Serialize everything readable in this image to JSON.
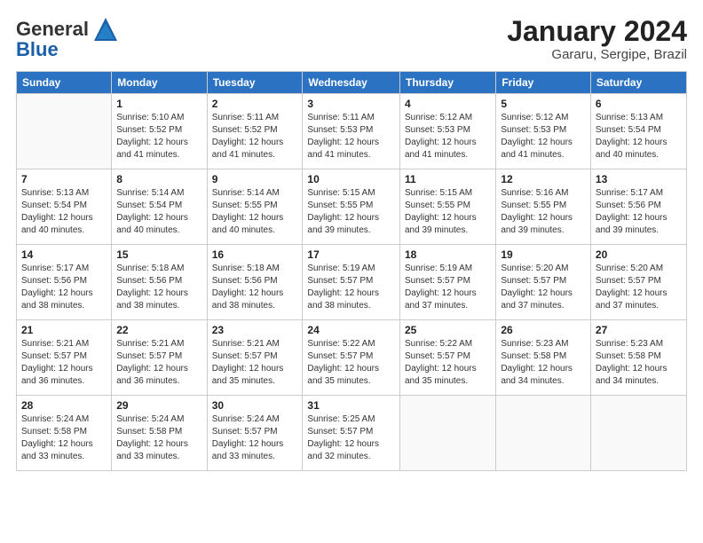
{
  "header": {
    "logo_general": "General",
    "logo_blue": "Blue",
    "month": "January 2024",
    "location": "Gararu, Sergipe, Brazil"
  },
  "weekdays": [
    "Sunday",
    "Monday",
    "Tuesday",
    "Wednesday",
    "Thursday",
    "Friday",
    "Saturday"
  ],
  "weeks": [
    [
      {
        "day": "",
        "info": ""
      },
      {
        "day": "1",
        "info": "Sunrise: 5:10 AM\nSunset: 5:52 PM\nDaylight: 12 hours\nand 41 minutes."
      },
      {
        "day": "2",
        "info": "Sunrise: 5:11 AM\nSunset: 5:52 PM\nDaylight: 12 hours\nand 41 minutes."
      },
      {
        "day": "3",
        "info": "Sunrise: 5:11 AM\nSunset: 5:53 PM\nDaylight: 12 hours\nand 41 minutes."
      },
      {
        "day": "4",
        "info": "Sunrise: 5:12 AM\nSunset: 5:53 PM\nDaylight: 12 hours\nand 41 minutes."
      },
      {
        "day": "5",
        "info": "Sunrise: 5:12 AM\nSunset: 5:53 PM\nDaylight: 12 hours\nand 41 minutes."
      },
      {
        "day": "6",
        "info": "Sunrise: 5:13 AM\nSunset: 5:54 PM\nDaylight: 12 hours\nand 40 minutes."
      }
    ],
    [
      {
        "day": "7",
        "info": "Sunrise: 5:13 AM\nSunset: 5:54 PM\nDaylight: 12 hours\nand 40 minutes."
      },
      {
        "day": "8",
        "info": "Sunrise: 5:14 AM\nSunset: 5:54 PM\nDaylight: 12 hours\nand 40 minutes."
      },
      {
        "day": "9",
        "info": "Sunrise: 5:14 AM\nSunset: 5:55 PM\nDaylight: 12 hours\nand 40 minutes."
      },
      {
        "day": "10",
        "info": "Sunrise: 5:15 AM\nSunset: 5:55 PM\nDaylight: 12 hours\nand 39 minutes."
      },
      {
        "day": "11",
        "info": "Sunrise: 5:15 AM\nSunset: 5:55 PM\nDaylight: 12 hours\nand 39 minutes."
      },
      {
        "day": "12",
        "info": "Sunrise: 5:16 AM\nSunset: 5:55 PM\nDaylight: 12 hours\nand 39 minutes."
      },
      {
        "day": "13",
        "info": "Sunrise: 5:17 AM\nSunset: 5:56 PM\nDaylight: 12 hours\nand 39 minutes."
      }
    ],
    [
      {
        "day": "14",
        "info": "Sunrise: 5:17 AM\nSunset: 5:56 PM\nDaylight: 12 hours\nand 38 minutes."
      },
      {
        "day": "15",
        "info": "Sunrise: 5:18 AM\nSunset: 5:56 PM\nDaylight: 12 hours\nand 38 minutes."
      },
      {
        "day": "16",
        "info": "Sunrise: 5:18 AM\nSunset: 5:56 PM\nDaylight: 12 hours\nand 38 minutes."
      },
      {
        "day": "17",
        "info": "Sunrise: 5:19 AM\nSunset: 5:57 PM\nDaylight: 12 hours\nand 38 minutes."
      },
      {
        "day": "18",
        "info": "Sunrise: 5:19 AM\nSunset: 5:57 PM\nDaylight: 12 hours\nand 37 minutes."
      },
      {
        "day": "19",
        "info": "Sunrise: 5:20 AM\nSunset: 5:57 PM\nDaylight: 12 hours\nand 37 minutes."
      },
      {
        "day": "20",
        "info": "Sunrise: 5:20 AM\nSunset: 5:57 PM\nDaylight: 12 hours\nand 37 minutes."
      }
    ],
    [
      {
        "day": "21",
        "info": "Sunrise: 5:21 AM\nSunset: 5:57 PM\nDaylight: 12 hours\nand 36 minutes."
      },
      {
        "day": "22",
        "info": "Sunrise: 5:21 AM\nSunset: 5:57 PM\nDaylight: 12 hours\nand 36 minutes."
      },
      {
        "day": "23",
        "info": "Sunrise: 5:21 AM\nSunset: 5:57 PM\nDaylight: 12 hours\nand 35 minutes."
      },
      {
        "day": "24",
        "info": "Sunrise: 5:22 AM\nSunset: 5:57 PM\nDaylight: 12 hours\nand 35 minutes."
      },
      {
        "day": "25",
        "info": "Sunrise: 5:22 AM\nSunset: 5:57 PM\nDaylight: 12 hours\nand 35 minutes."
      },
      {
        "day": "26",
        "info": "Sunrise: 5:23 AM\nSunset: 5:58 PM\nDaylight: 12 hours\nand 34 minutes."
      },
      {
        "day": "27",
        "info": "Sunrise: 5:23 AM\nSunset: 5:58 PM\nDaylight: 12 hours\nand 34 minutes."
      }
    ],
    [
      {
        "day": "28",
        "info": "Sunrise: 5:24 AM\nSunset: 5:58 PM\nDaylight: 12 hours\nand 33 minutes."
      },
      {
        "day": "29",
        "info": "Sunrise: 5:24 AM\nSunset: 5:58 PM\nDaylight: 12 hours\nand 33 minutes."
      },
      {
        "day": "30",
        "info": "Sunrise: 5:24 AM\nSunset: 5:57 PM\nDaylight: 12 hours\nand 33 minutes."
      },
      {
        "day": "31",
        "info": "Sunrise: 5:25 AM\nSunset: 5:57 PM\nDaylight: 12 hours\nand 32 minutes."
      },
      {
        "day": "",
        "info": ""
      },
      {
        "day": "",
        "info": ""
      },
      {
        "day": "",
        "info": ""
      }
    ]
  ]
}
